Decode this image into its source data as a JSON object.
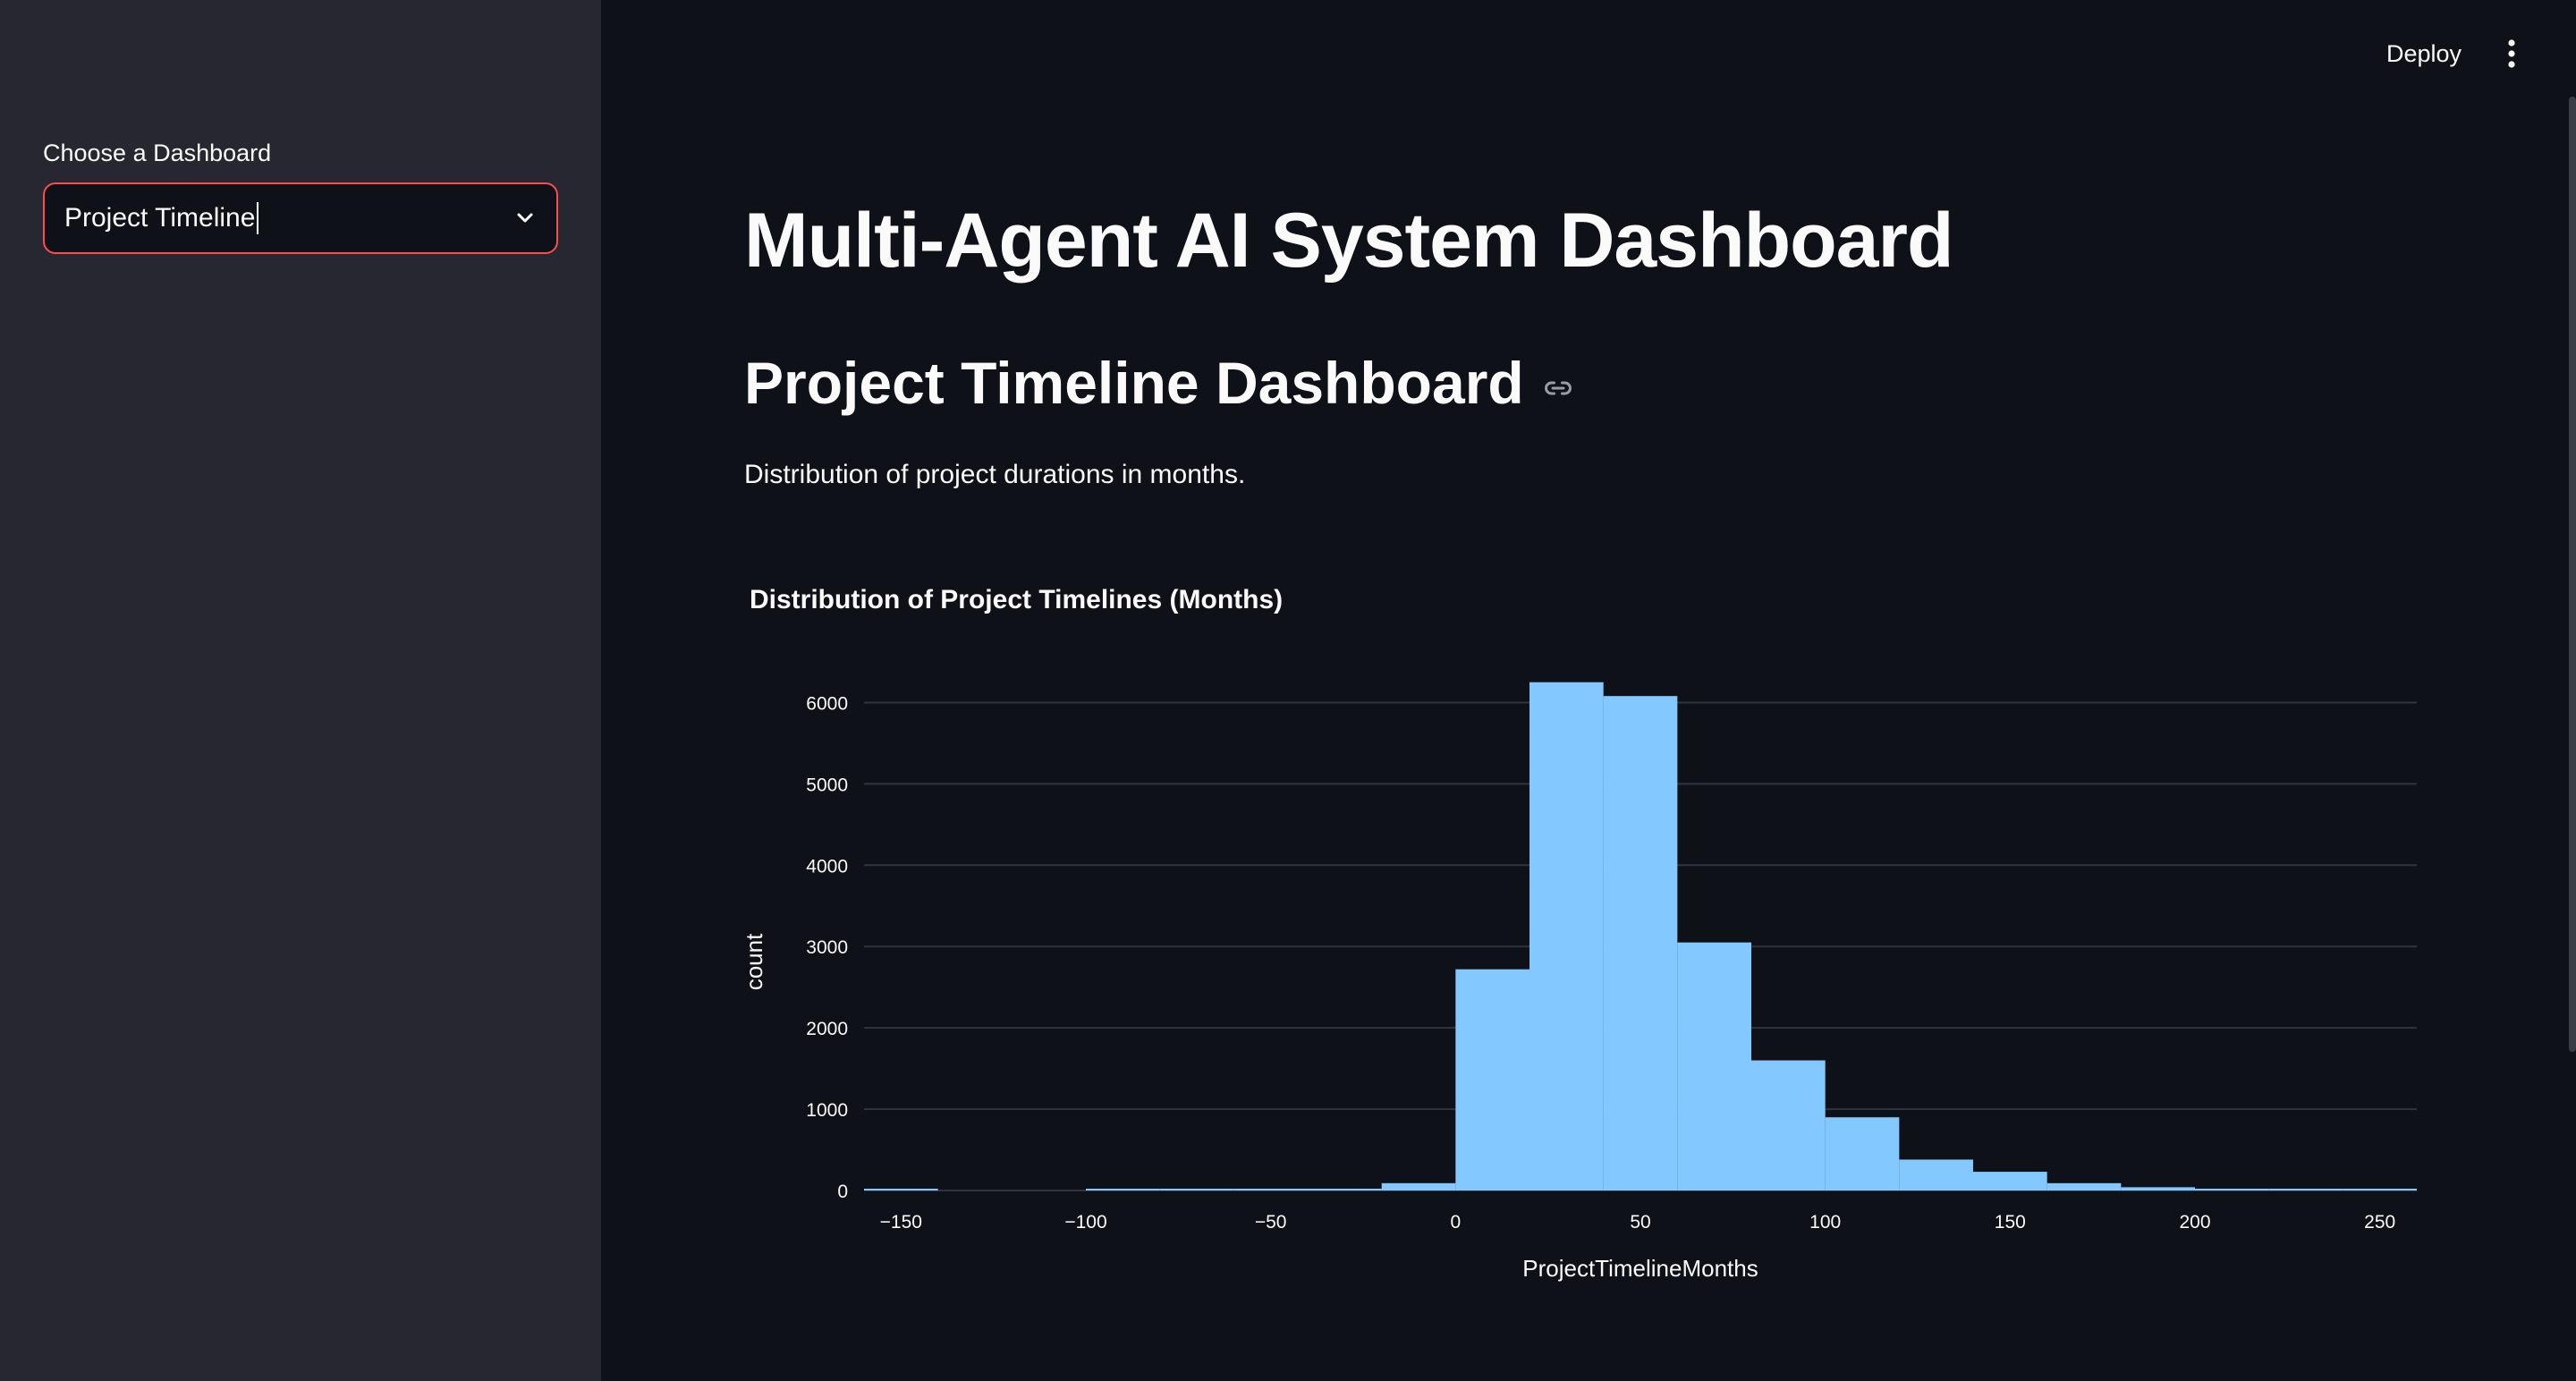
{
  "sidebar": {
    "select_label": "Choose a Dashboard",
    "select_value": "Project Timeline"
  },
  "header": {
    "deploy_label": "Deploy"
  },
  "main": {
    "title": "Multi-Agent AI System Dashboard",
    "section_title": "Project Timeline Dashboard",
    "caption": "Distribution of project durations in months."
  },
  "colors": {
    "bar": "#83c9ff",
    "grid": "#31333f",
    "accent": "#ff4b4b"
  },
  "chart_data": {
    "type": "bar",
    "title": "Distribution of Project Timelines (Months)",
    "xlabel": "ProjectTimelineMonths",
    "ylabel": "count",
    "xlim": [
      -160,
      260
    ],
    "ylim": [
      0,
      6500
    ],
    "yticks": [
      0,
      1000,
      2000,
      3000,
      4000,
      5000,
      6000
    ],
    "xticks": [
      -150,
      -100,
      -50,
      0,
      50,
      100,
      150,
      200,
      250
    ],
    "xtick_labels": [
      "−150",
      "−100",
      "−50",
      "0",
      "50",
      "100",
      "150",
      "200",
      "250"
    ],
    "bin_width": 20,
    "bins": [
      {
        "x0": -160,
        "x1": -140,
        "count": 10
      },
      {
        "x0": -140,
        "x1": -120,
        "count": 0
      },
      {
        "x0": -120,
        "x1": -100,
        "count": 0
      },
      {
        "x0": -100,
        "x1": -80,
        "count": 8
      },
      {
        "x0": -80,
        "x1": -60,
        "count": 8
      },
      {
        "x0": -60,
        "x1": -40,
        "count": 8
      },
      {
        "x0": -40,
        "x1": -20,
        "count": 10
      },
      {
        "x0": -20,
        "x1": 0,
        "count": 90
      },
      {
        "x0": 0,
        "x1": 20,
        "count": 2720
      },
      {
        "x0": 20,
        "x1": 40,
        "count": 6250
      },
      {
        "x0": 40,
        "x1": 60,
        "count": 6080
      },
      {
        "x0": 60,
        "x1": 80,
        "count": 3050
      },
      {
        "x0": 80,
        "x1": 100,
        "count": 1600
      },
      {
        "x0": 100,
        "x1": 120,
        "count": 900
      },
      {
        "x0": 120,
        "x1": 140,
        "count": 380
      },
      {
        "x0": 140,
        "x1": 160,
        "count": 230
      },
      {
        "x0": 160,
        "x1": 180,
        "count": 90
      },
      {
        "x0": 180,
        "x1": 200,
        "count": 40
      },
      {
        "x0": 200,
        "x1": 220,
        "count": 15
      },
      {
        "x0": 220,
        "x1": 240,
        "count": 10
      },
      {
        "x0": 240,
        "x1": 260,
        "count": 10
      }
    ]
  }
}
